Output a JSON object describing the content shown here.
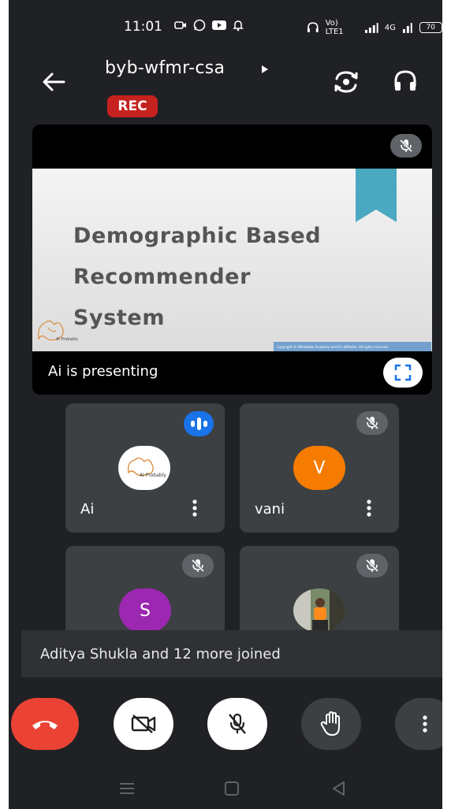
{
  "status_bar": {
    "time": "11:01",
    "network_label": "Vo) LTE1",
    "network_gen": "4G",
    "battery": "70"
  },
  "header": {
    "meeting_code": "byb-wfmr-csa",
    "rec_label": "REC"
  },
  "presentation": {
    "slide_lines": [
      "Demographic Based",
      "Recommender",
      "System"
    ],
    "slide_logo_text": "AI Probably",
    "slide_copyright": "Copyright © AIProbably Academy and It's affiliates. All rights reserved.",
    "presenting_label": "Ai is presenting",
    "ribbon_color": "#4aa8c0"
  },
  "participants": [
    {
      "name": "Ai",
      "avatar_text": "AI Probably",
      "status": "speaking"
    },
    {
      "name": "vani",
      "avatar_letter": "V",
      "avatar_color": "#f57c00",
      "status": "muted"
    },
    {
      "name": "",
      "avatar_letter": "S",
      "avatar_color": "#9c27b0",
      "status": "muted"
    },
    {
      "name": "",
      "avatar_letter": "",
      "status": "muted"
    }
  ],
  "toast": {
    "message": "Aditya Shukla and 12 more joined"
  },
  "controls": [
    "end-call",
    "camera-off",
    "mic-off",
    "raise-hand",
    "more-options"
  ],
  "colors": {
    "background": "#202124",
    "tile": "#3c4043",
    "rec": "#c5221f",
    "end_call": "#ea4335",
    "speaking": "#1a73e8"
  }
}
